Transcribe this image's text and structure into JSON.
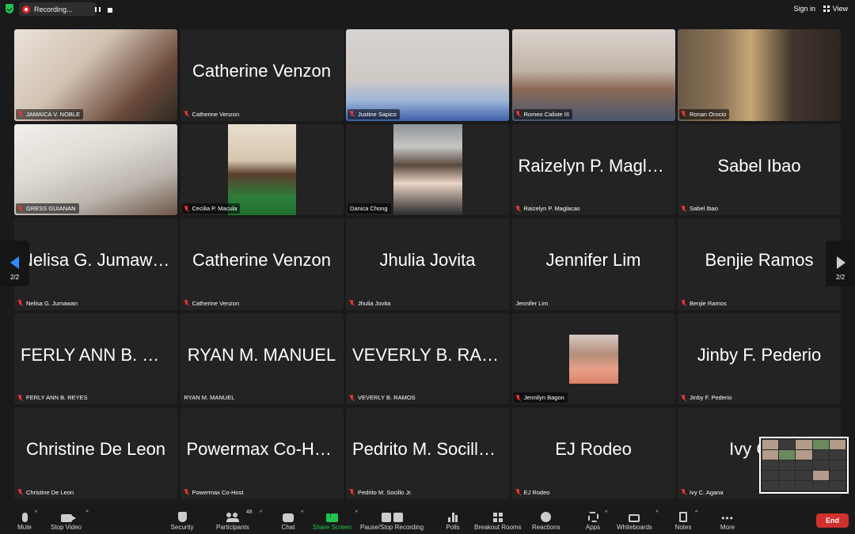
{
  "topbar": {
    "recording_label": "Recording...",
    "sign_in": "Sign in",
    "view": "View"
  },
  "tiles": [
    {
      "big": "",
      "label": "JAMAICA V. NOBLE",
      "muted": true,
      "video": "v-group"
    },
    {
      "big": "Catherine Venzon",
      "label": "Catherine Venzon",
      "muted": true,
      "video": ""
    },
    {
      "big": "",
      "label": "Justine Sapico",
      "muted": true,
      "video": "v-justine"
    },
    {
      "big": "",
      "label": "Romeo Caliste III",
      "muted": true,
      "video": "v-romeo"
    },
    {
      "big": "",
      "label": "Ronan Orocio",
      "muted": true,
      "video": "v-ronan"
    },
    {
      "big": "",
      "label": "GRESS GUIANAN",
      "muted": true,
      "video": "v-gress"
    },
    {
      "big": "",
      "label": "Cecilia P. Macula",
      "muted": true,
      "video": "v-cecilia"
    },
    {
      "big": "",
      "label": "Danica Chong",
      "muted": false,
      "video": "v-danica"
    },
    {
      "big": "Raizelyn P. Magla…",
      "label": "Raizelyn P. Maglacas",
      "muted": true,
      "video": ""
    },
    {
      "big": "Sabel Ibao",
      "label": "Sabel Ibao",
      "muted": true,
      "video": ""
    },
    {
      "big": "Nelisa G. Jumawan",
      "label": "Nelisa G. Jumawan",
      "muted": true,
      "video": ""
    },
    {
      "big": "Catherine Venzon",
      "label": "Catherine Venzon",
      "muted": true,
      "video": ""
    },
    {
      "big": "Jhulia Jovita",
      "label": "Jhulia Jovita",
      "muted": true,
      "video": ""
    },
    {
      "big": "Jennifer Lim",
      "label": "Jennifer Lim",
      "muted": false,
      "video": ""
    },
    {
      "big": "Benjie Ramos",
      "label": "Benjie Ramos",
      "muted": true,
      "video": ""
    },
    {
      "big": "FERLY ANN B. RE…",
      "label": "FERLY ANN B. REYES",
      "muted": true,
      "video": ""
    },
    {
      "big": "RYAN M. MANUEL",
      "label": "RYAN M. MANUEL",
      "muted": false,
      "video": ""
    },
    {
      "big": "VEVERLY B. RAM…",
      "label": "VEVERLY B. RAMOS",
      "muted": true,
      "video": ""
    },
    {
      "big": "",
      "label": "Jennilyn Bagon",
      "muted": true,
      "video": "v-jennilyn"
    },
    {
      "big": "Jinby F. Pederio",
      "label": "Jinby F. Pederio",
      "muted": true,
      "video": ""
    },
    {
      "big": "Christine De Leon",
      "label": "Christine De Leon",
      "muted": true,
      "video": ""
    },
    {
      "big": "Powermax Co-Ho…",
      "label": "Powermax Co-Host",
      "muted": true,
      "video": ""
    },
    {
      "big": "Pedrito M. Socillo…",
      "label": "Pedrito M. Socillo Jr.",
      "muted": true,
      "video": ""
    },
    {
      "big": "EJ Rodeo",
      "label": "EJ Rodeo",
      "muted": true,
      "video": ""
    },
    {
      "big": "Ivy C. A",
      "label": "Ivy C. Agana",
      "muted": true,
      "video": ""
    }
  ],
  "pager": {
    "left": "2/2",
    "right": "2/2"
  },
  "toolbar": {
    "mute": "Mute",
    "stop_video": "Stop Video",
    "security": "Security",
    "participants": "Participants",
    "participants_count": "48",
    "chat": "Chat",
    "share_screen": "Share Screen",
    "pause_stop_recording": "Pause/Stop Recording",
    "polls": "Polls",
    "breakout_rooms": "Breakout Rooms",
    "reactions": "Reactions",
    "apps": "Apps",
    "whiteboards": "Whiteboards",
    "notes": "Notes",
    "more": "More",
    "end": "End"
  },
  "colors": {
    "accent_blue": "#2d8cff",
    "share_green": "#23c552",
    "end_red": "#d0312d",
    "tile_bg": "#232323"
  }
}
